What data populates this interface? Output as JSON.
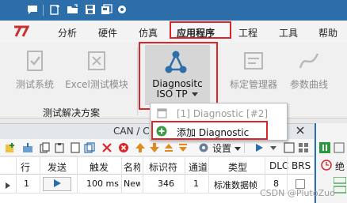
{
  "menu": {
    "items": [
      "分析",
      "硬件",
      "仿真",
      "应用程序",
      "工程",
      "工具",
      "帮助"
    ],
    "active": "应用程序"
  },
  "ribbon": {
    "test_system": "测试系统",
    "excel_module": "Excel测试模块",
    "diagnostic_line1": "Diagnositc",
    "diagnostic_line2": "ISO TP",
    "calibration_manager": "标定管理器",
    "param_curve": "参数曲线",
    "group_label": "测试解决方案"
  },
  "dropdown": {
    "item1": "[1] Diagnostic [#2]",
    "item2": "添加 Diagnostic"
  },
  "can_window": {
    "title": "CAN / C",
    "settings_label": "设置"
  },
  "table": {
    "headers": [
      "行",
      "发送",
      "触发",
      "名称",
      "标识符",
      "通道",
      "类型",
      "DLC",
      "BRS"
    ],
    "row": {
      "line": "1",
      "trigger": "100 ms",
      "name": "New",
      "id": "346",
      "channel": "1",
      "type": "标准数据帧",
      "dlc": "8"
    }
  },
  "right_panel": {
    "label": "绝"
  },
  "watermark": "CSDN @PlutoZuo",
  "colors": {
    "accent_blue": "#2b6ea9",
    "highlight_red": "#d9262a"
  }
}
